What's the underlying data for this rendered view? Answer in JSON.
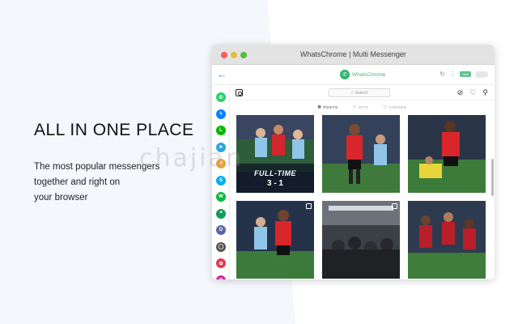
{
  "promo": {
    "headline": "ALL IN ONE PLACE",
    "sub_lines": [
      "The most popular messengers",
      "together and right on",
      "your browser"
    ]
  },
  "watermark": "chajian",
  "window": {
    "title": "WhatsChrome | Multi Messenger"
  },
  "app_header": {
    "back_icon": "back-arrow-icon",
    "brand_name": "WhatsChrome",
    "pill_label": "new",
    "accent_color": "#2fb46a"
  },
  "sidebar": {
    "items": [
      {
        "name": "whatsapp",
        "glyph": "✆",
        "color": "#25d366"
      },
      {
        "name": "messenger",
        "glyph": "ϟ",
        "color": "#0084ff"
      },
      {
        "name": "line",
        "glyph": "L",
        "color": "#00b900"
      },
      {
        "name": "telegram",
        "glyph": "➤",
        "color": "#2ca5e0"
      },
      {
        "name": "slack",
        "glyph": "#",
        "color": "#e8a33b"
      },
      {
        "name": "skype",
        "glyph": "S",
        "color": "#00aff0"
      },
      {
        "name": "wechat",
        "glyph": "W",
        "color": "#09b83e"
      },
      {
        "name": "hangouts",
        "glyph": "❝",
        "color": "#0f9d58"
      },
      {
        "name": "discord",
        "glyph": "D",
        "color": "#5865a8"
      },
      {
        "name": "chat",
        "glyph": "◯",
        "color": "#555555"
      },
      {
        "name": "icq",
        "glyph": "✿",
        "color": "#e8374a"
      },
      {
        "name": "instagram",
        "glyph": "◎",
        "color": "#d6249f"
      }
    ]
  },
  "instagram": {
    "search_placeholder": "Search",
    "tabs": [
      {
        "label": "POSTS",
        "active": true
      },
      {
        "label": "IGTV",
        "active": false
      },
      {
        "label": "TAGGED",
        "active": false
      }
    ],
    "posts": [
      {
        "id": 1,
        "overlay_title": "FULL-TIME",
        "overlay_score": "3 - 1"
      },
      {
        "id": 2
      },
      {
        "id": 3
      },
      {
        "id": 4
      },
      {
        "id": 5
      },
      {
        "id": 6
      }
    ]
  }
}
